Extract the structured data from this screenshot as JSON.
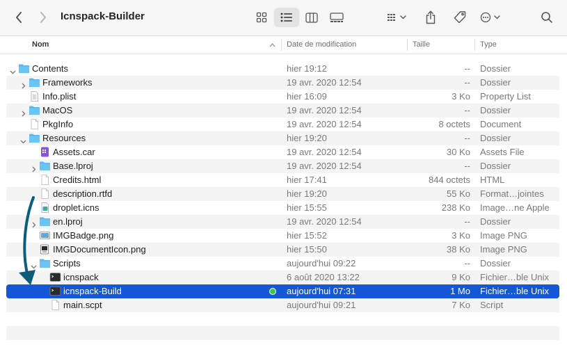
{
  "window": {
    "title": "Icnspack-Builder",
    "icons": {
      "back": "chevron-left-icon",
      "forward": "chevron-right-icon",
      "icon_view": "grid-icon",
      "list_view": "list-icon",
      "column_view": "columns-icon",
      "gallery_view": "gallery-icon",
      "group": "group-icon",
      "share": "share-icon",
      "tag": "tag-icon",
      "more": "ellipsis-icon",
      "search": "search-icon"
    },
    "active_view": "list"
  },
  "columns": {
    "name": "Nom",
    "date": "Date de modification",
    "size": "Taille",
    "kind": "Type"
  },
  "colors": {
    "selection": "#1357d5",
    "folder": "#5ab8f0",
    "tag_green": "#3ec34f",
    "arrow": "#0c5d7a"
  },
  "rows": [
    {
      "name": "Contents",
      "date": "hier 19:12",
      "size": "--",
      "kind": "Dossier",
      "depth": 0,
      "icon": "folder",
      "expand": "open"
    },
    {
      "name": "Frameworks",
      "date": "19 avr. 2020 12:54",
      "size": "--",
      "kind": "Dossier",
      "depth": 1,
      "icon": "folder",
      "expand": "closed"
    },
    {
      "name": "Info.plist",
      "date": "hier 16:09",
      "size": "3 Ko",
      "kind": "Property List",
      "depth": 1,
      "icon": "plist",
      "expand": "none"
    },
    {
      "name": "MacOS",
      "date": "19 avr. 2020 12:54",
      "size": "--",
      "kind": "Dossier",
      "depth": 1,
      "icon": "folder",
      "expand": "closed"
    },
    {
      "name": "PkgInfo",
      "date": "19 avr. 2020 12:54",
      "size": "8 octets",
      "kind": "Document",
      "depth": 1,
      "icon": "doc",
      "expand": "none"
    },
    {
      "name": "Resources",
      "date": "hier 19:20",
      "size": "--",
      "kind": "Dossier",
      "depth": 1,
      "icon": "folder",
      "expand": "open"
    },
    {
      "name": "Assets.car",
      "date": "19 avr. 2020 12:54",
      "size": "30 Ko",
      "kind": "Assets File",
      "depth": 2,
      "icon": "assets",
      "expand": "none"
    },
    {
      "name": "Base.lproj",
      "date": "19 avr. 2020 12:54",
      "size": "--",
      "kind": "Dossier",
      "depth": 2,
      "icon": "folder",
      "expand": "closed"
    },
    {
      "name": "Credits.html",
      "date": "hier 17:41",
      "size": "844 octets",
      "kind": "HTML",
      "depth": 2,
      "icon": "doc",
      "expand": "none"
    },
    {
      "name": "description.rtfd",
      "date": "hier 19:20",
      "size": "55 Ko",
      "kind": "Format…jointes",
      "depth": 2,
      "icon": "doc",
      "expand": "none"
    },
    {
      "name": "droplet.icns",
      "date": "hier 15:55",
      "size": "238 Ko",
      "kind": "Image…ne Apple",
      "depth": 2,
      "icon": "icns",
      "expand": "none"
    },
    {
      "name": "en.lproj",
      "date": "19 avr. 2020 12:54",
      "size": "--",
      "kind": "Dossier",
      "depth": 2,
      "icon": "folder",
      "expand": "closed"
    },
    {
      "name": "IMGBadge.png",
      "date": "hier 15:52",
      "size": "3 Ko",
      "kind": "Image PNG",
      "depth": 2,
      "icon": "image",
      "expand": "none"
    },
    {
      "name": "IMGDocumentIcon.png",
      "date": "hier 15:50",
      "size": "38 Ko",
      "kind": "Image PNG",
      "depth": 2,
      "icon": "image2",
      "expand": "none"
    },
    {
      "name": "Scripts",
      "date": "aujourd'hui 09:22",
      "size": "--",
      "kind": "Dossier",
      "depth": 2,
      "icon": "folder",
      "expand": "open"
    },
    {
      "name": "icnspack",
      "date": "6 août 2020 13:22",
      "size": "9 Ko",
      "kind": "Fichier…ble Unix",
      "depth": 3,
      "icon": "exec",
      "expand": "none"
    },
    {
      "name": "icnspack-Build",
      "date": "aujourd'hui 07:31",
      "size": "1 Mo",
      "kind": "Fichier…ble Unix",
      "depth": 3,
      "icon": "exec",
      "expand": "none",
      "selected": true,
      "tag": "green"
    },
    {
      "name": "main.scpt",
      "date": "aujourd'hui 09:21",
      "size": "7 Ko",
      "kind": "Script",
      "depth": 3,
      "icon": "doc",
      "expand": "none"
    }
  ]
}
